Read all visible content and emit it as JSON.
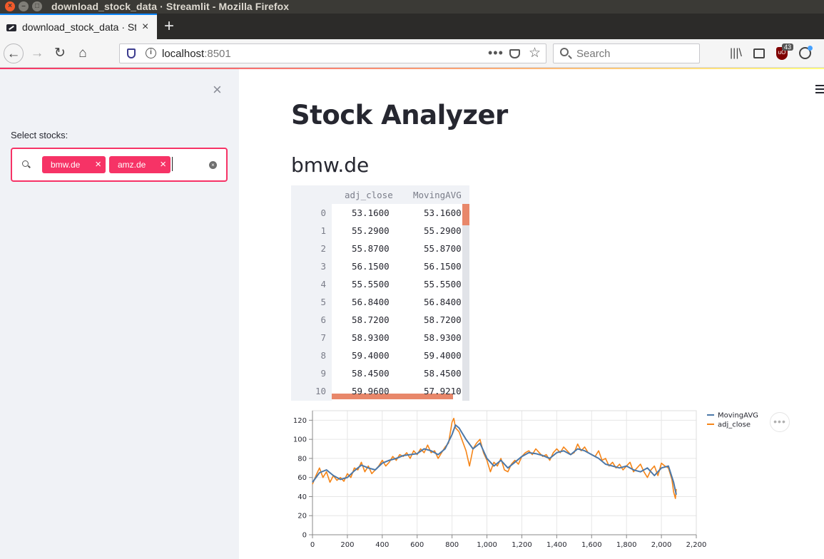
{
  "window": {
    "title": "download_stock_data · Streamlit - Mozilla Firefox"
  },
  "tab": {
    "title": "download_stock_data · Streamlit",
    "close": "×",
    "new_tab": "+"
  },
  "navbar": {
    "url_host": "localhost",
    "url_port": ":8501",
    "url_dots": "•••",
    "search_placeholder": "Search",
    "ublock_count": "43"
  },
  "sidebar": {
    "close": "×",
    "label": "Select stocks:",
    "chips": [
      {
        "label": "bmw.de"
      },
      {
        "label": "amz.de"
      }
    ],
    "chip_remove": "×"
  },
  "main": {
    "title": "Stock Analyzer",
    "subheader": "bmw.de",
    "table": {
      "columns": [
        "adj_close",
        "MovingAVG"
      ],
      "rows": [
        [
          "0",
          "53.1600",
          "53.1600"
        ],
        [
          "1",
          "55.2900",
          "55.2900"
        ],
        [
          "2",
          "55.8700",
          "55.8700"
        ],
        [
          "3",
          "56.1500",
          "56.1500"
        ],
        [
          "4",
          "55.5500",
          "55.5500"
        ],
        [
          "5",
          "56.8400",
          "56.8400"
        ],
        [
          "6",
          "58.7200",
          "58.7200"
        ],
        [
          "7",
          "58.9300",
          "58.9300"
        ],
        [
          "8",
          "59.4000",
          "59.4000"
        ],
        [
          "9",
          "58.4500",
          "58.4500"
        ],
        [
          "10",
          "59.9600",
          "57.9210"
        ]
      ]
    },
    "chart_menu": "•••"
  },
  "chart_data": {
    "type": "line",
    "xlim": [
      0,
      2200
    ],
    "ylim": [
      0,
      130
    ],
    "x_ticks": [
      "0",
      "200",
      "400",
      "600",
      "800",
      "1,000",
      "1,200",
      "1,400",
      "1,600",
      "1,800",
      "2,000",
      "2,200"
    ],
    "y_ticks": [
      "0",
      "20",
      "40",
      "60",
      "80",
      "100",
      "120"
    ],
    "grid": true,
    "legend_position": "top-right",
    "series": [
      {
        "name": "MovingAVG",
        "color": "#4c78a8",
        "x": [
          0,
          40,
          80,
          120,
          160,
          200,
          240,
          280,
          320,
          360,
          400,
          440,
          480,
          520,
          560,
          600,
          640,
          680,
          720,
          760,
          800,
          820,
          840,
          880,
          920,
          960,
          1000,
          1040,
          1080,
          1120,
          1160,
          1200,
          1240,
          1280,
          1320,
          1360,
          1400,
          1440,
          1480,
          1520,
          1560,
          1600,
          1640,
          1680,
          1720,
          1760,
          1800,
          1840,
          1880,
          1920,
          1960,
          2000,
          2040,
          2070,
          2085
        ],
        "y": [
          55,
          65,
          68,
          62,
          58,
          60,
          67,
          73,
          70,
          68,
          75,
          78,
          80,
          83,
          84,
          85,
          90,
          88,
          84,
          90,
          105,
          115,
          112,
          100,
          90,
          96,
          80,
          72,
          78,
          70,
          76,
          82,
          86,
          85,
          83,
          80,
          86,
          88,
          84,
          90,
          88,
          84,
          80,
          74,
          72,
          70,
          72,
          68,
          66,
          70,
          62,
          70,
          72,
          55,
          42
        ]
      },
      {
        "name": "adj_close",
        "color": "#f58518",
        "x": [
          0,
          20,
          40,
          60,
          80,
          100,
          120,
          140,
          160,
          180,
          200,
          220,
          240,
          260,
          280,
          300,
          320,
          340,
          360,
          380,
          400,
          420,
          440,
          460,
          480,
          500,
          520,
          540,
          560,
          580,
          600,
          620,
          640,
          660,
          680,
          700,
          720,
          740,
          760,
          780,
          800,
          810,
          820,
          840,
          860,
          880,
          900,
          920,
          940,
          960,
          980,
          1000,
          1020,
          1040,
          1060,
          1080,
          1100,
          1120,
          1140,
          1160,
          1180,
          1200,
          1220,
          1240,
          1260,
          1280,
          1300,
          1320,
          1340,
          1360,
          1380,
          1400,
          1420,
          1440,
          1460,
          1480,
          1500,
          1520,
          1540,
          1560,
          1580,
          1600,
          1620,
          1640,
          1660,
          1680,
          1700,
          1720,
          1740,
          1760,
          1780,
          1800,
          1820,
          1840,
          1860,
          1880,
          1900,
          1920,
          1940,
          1960,
          1980,
          2000,
          2020,
          2040,
          2060,
          2070,
          2080,
          2085
        ],
        "y": [
          53,
          62,
          70,
          60,
          66,
          55,
          62,
          57,
          60,
          56,
          64,
          60,
          70,
          68,
          76,
          66,
          72,
          64,
          68,
          72,
          78,
          72,
          76,
          82,
          78,
          84,
          82,
          86,
          80,
          88,
          84,
          90,
          86,
          94,
          86,
          88,
          80,
          86,
          92,
          96,
          118,
          122,
          112,
          108,
          98,
          88,
          72,
          90,
          96,
          100,
          86,
          78,
          66,
          76,
          72,
          80,
          68,
          66,
          74,
          78,
          74,
          82,
          86,
          88,
          84,
          90,
          86,
          82,
          84,
          78,
          86,
          90,
          86,
          92,
          88,
          84,
          86,
          95,
          88,
          92,
          86,
          84,
          82,
          88,
          78,
          80,
          72,
          76,
          70,
          74,
          68,
          72,
          76,
          66,
          70,
          74,
          66,
          60,
          68,
          72,
          62,
          75,
          72,
          70,
          58,
          45,
          38,
          48
        ]
      }
    ]
  }
}
